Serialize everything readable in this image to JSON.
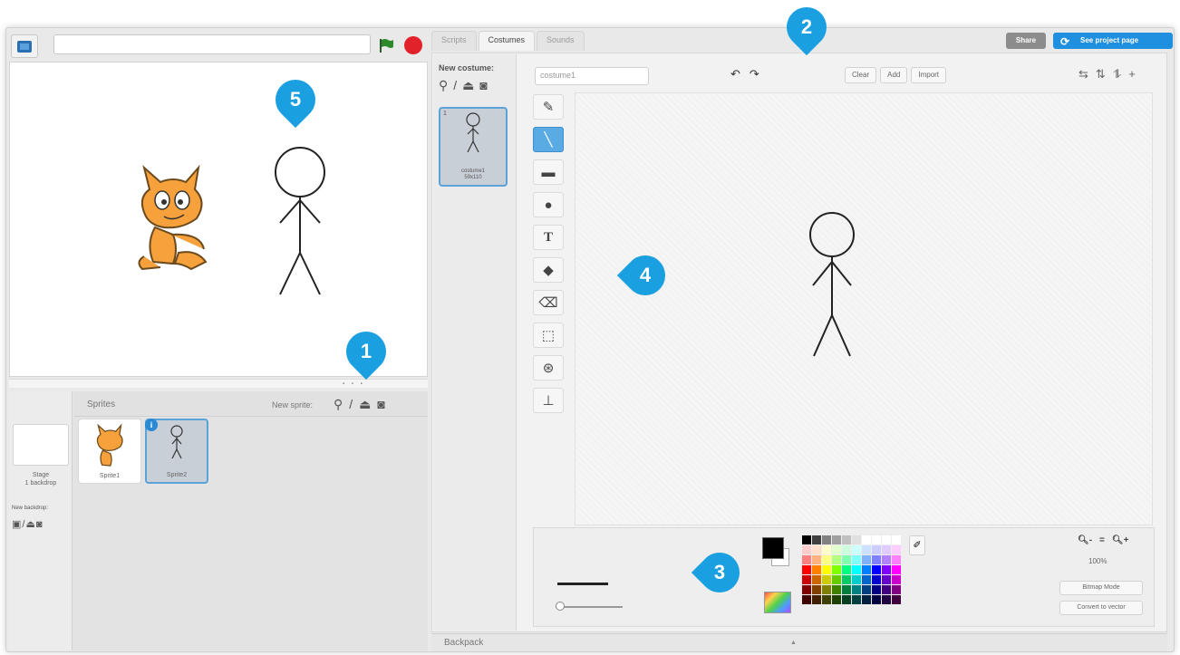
{
  "topbar": {
    "project_title": "",
    "colors": {
      "stop": "#e2222a",
      "flag": "#2c8a2c"
    }
  },
  "stage": {
    "sprites": [
      "cat",
      "stick-figure"
    ]
  },
  "sprites_panel": {
    "title": "Sprites",
    "new_sprite_label": "New sprite:",
    "stage_label_1": "Stage",
    "stage_label_2": "1 backdrop",
    "new_backdrop_label": "New backdrop:",
    "sprites": [
      {
        "name": "Sprite1",
        "selected": false
      },
      {
        "name": "Sprite2",
        "selected": true
      }
    ]
  },
  "tabs": {
    "scripts": "Scripts",
    "costumes": "Costumes",
    "sounds": "Sounds",
    "active": "Costumes"
  },
  "header_buttons": {
    "share": "Share",
    "project_page": "See project page",
    "colors": {
      "share": "#8c8c8c",
      "project_page": "#1f8fe0"
    }
  },
  "costumes": {
    "new_costume_label": "New costume:",
    "items": [
      {
        "number": "1",
        "name": "costume1",
        "size": "59x110"
      }
    ]
  },
  "paint_editor": {
    "costume_name": "costume1",
    "clear": "Clear",
    "add": "Add",
    "import": "Import",
    "tools": [
      "brush",
      "line",
      "rectangle",
      "ellipse",
      "text",
      "fill",
      "eraser",
      "select",
      "select-remove-background",
      "stamp"
    ],
    "active_tool": "line",
    "zoom": "100%",
    "bitmap_mode": "Bitmap Mode",
    "convert_to_vector": "Convert to vector",
    "accent_color": "#5aaae3"
  },
  "backpack": {
    "label": "Backpack"
  },
  "callouts": [
    "1",
    "2",
    "3",
    "4",
    "5"
  ]
}
